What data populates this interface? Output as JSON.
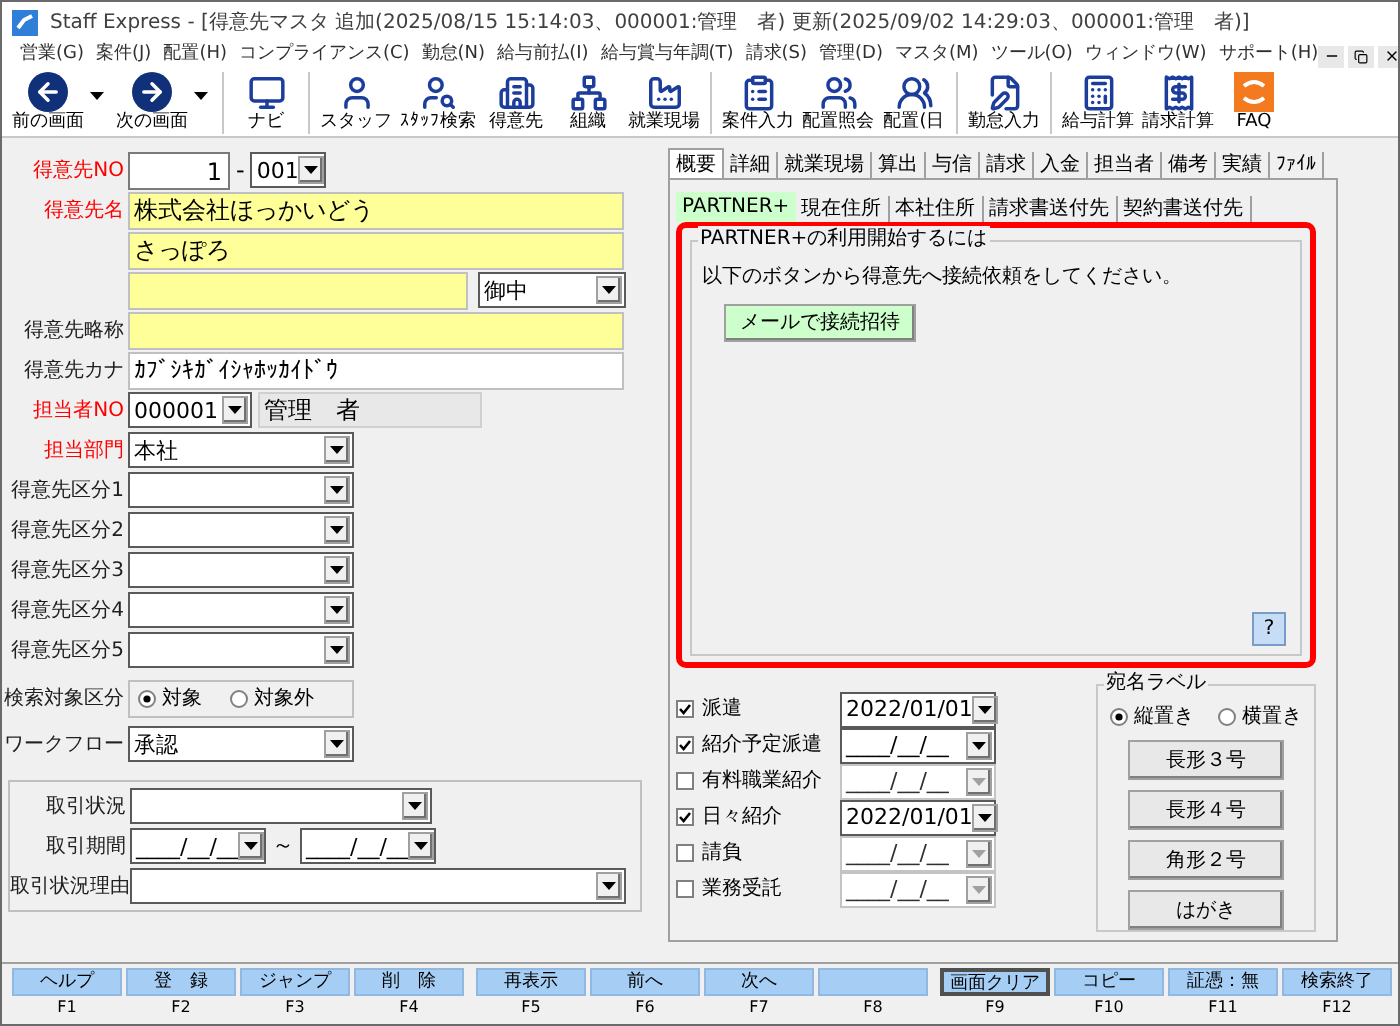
{
  "window": {
    "title": "Staff Express - [得意先マスタ  追加(2025/08/15 15:14:03、000001:管理　者) 更新(2025/09/02 14:29:03、000001:管理　者)]"
  },
  "menu": [
    {
      "label": "営業(G)"
    },
    {
      "label": "案件(J)"
    },
    {
      "label": "配置(H)"
    },
    {
      "label": "コンプライアンス(C)"
    },
    {
      "label": "勤怠(N)"
    },
    {
      "label": "給与前払(I)"
    },
    {
      "label": "給与賞与年調(T)"
    },
    {
      "label": "請求(S)"
    },
    {
      "label": "管理(D)"
    },
    {
      "label": "マスタ(M)"
    },
    {
      "label": "ツール(O)"
    },
    {
      "label": "ウィンドウ(W)"
    },
    {
      "label": "サポート(H)"
    }
  ],
  "toolbar": [
    {
      "items": [
        {
          "label": "前の画面",
          "dropdown": true
        },
        {
          "label": "次の画面",
          "dropdown": true
        }
      ]
    },
    {
      "items": [
        {
          "label": "ナビ",
          "dropdown": false
        }
      ]
    },
    {
      "items": [
        {
          "label": "スタッフ",
          "dropdown": false
        },
        {
          "label": "ｽﾀｯﾌ検索",
          "dropdown": false
        },
        {
          "label": "得意先",
          "dropdown": false
        },
        {
          "label": "組織",
          "dropdown": false
        },
        {
          "label": "就業現場",
          "dropdown": false
        }
      ]
    },
    {
      "items": [
        {
          "label": "案件入力",
          "dropdown": false
        },
        {
          "label": "配置照会",
          "dropdown": false
        },
        {
          "label": "配置(日",
          "dropdown": false
        }
      ]
    },
    {
      "items": [
        {
          "label": "勤怠入力",
          "dropdown": false
        }
      ]
    },
    {
      "items": [
        {
          "label": "給与計算",
          "dropdown": false
        },
        {
          "label": "請求計算",
          "dropdown": false
        },
        {
          "label": "FAQ",
          "dropdown": false
        }
      ]
    }
  ],
  "form": {
    "rows": [
      {
        "kind": "number",
        "label": "得意先NO",
        "required": true,
        "value": "1",
        "separator": "-",
        "code": "001"
      },
      {
        "kind": "text",
        "label": "得意先名",
        "required": true,
        "value": "株式会社ほっかいどう",
        "highlight": true
      },
      {
        "kind": "text",
        "value": "さっぽろ",
        "highlight": true
      },
      {
        "kind": "text_select",
        "highlight": true,
        "select": "御中"
      },
      {
        "kind": "text",
        "label": "得意先略称",
        "required": false,
        "highlight": true
      },
      {
        "kind": "text",
        "label": "得意先カナ",
        "required": false,
        "value": "ｶﾌﾞｼｷｶﾞｲｼｬﾎｯｶｲﾄﾞｳ",
        "highlight": false
      },
      {
        "kind": "staff",
        "label": "担当者NO",
        "required": true,
        "value": "000001",
        "name": "管理　者"
      },
      {
        "kind": "select",
        "label": "担当部門",
        "required": true,
        "value": "本社"
      },
      {
        "kind": "select",
        "label": "得意先区分1",
        "required": false
      },
      {
        "kind": "select",
        "label": "得意先区分2",
        "required": false
      },
      {
        "kind": "select",
        "label": "得意先区分3",
        "required": false
      },
      {
        "kind": "select",
        "label": "得意先区分4",
        "required": false
      },
      {
        "kind": "select",
        "label": "得意先区分5",
        "required": false
      },
      {
        "kind": "radio",
        "label": "検索対象区分",
        "required": false,
        "options": [
          {
            "label": "対象",
            "selected": true
          },
          {
            "label": "対象外",
            "selected": false
          }
        ]
      },
      {
        "kind": "select",
        "label": "ワークフロー",
        "required": false,
        "value": "承認"
      }
    ]
  },
  "transaction": {
    "rows": [
      {
        "kind": "select",
        "label": "取引状況"
      },
      {
        "kind": "date_range",
        "label": "取引期間",
        "from": "____/__/__",
        "separator": "～",
        "to": "____/__/__"
      },
      {
        "kind": "select_wide",
        "label": "取引状況理由"
      }
    ]
  },
  "tabs": [
    {
      "label": "概要",
      "selected": true
    },
    {
      "label": "詳細",
      "selected": false
    },
    {
      "label": "就業現場",
      "selected": false
    },
    {
      "label": "算出",
      "selected": false
    },
    {
      "label": "与信",
      "selected": false
    },
    {
      "label": "請求",
      "selected": false
    },
    {
      "label": "入金",
      "selected": false
    },
    {
      "label": "担当者",
      "selected": false
    },
    {
      "label": "備考",
      "selected": false
    },
    {
      "label": "実績",
      "selected": false
    },
    {
      "label": "ﾌｧｲﾙ",
      "selected": false
    }
  ],
  "subtabs": [
    {
      "label": "PARTNER+",
      "selected": true
    },
    {
      "label": "現在住所",
      "selected": false
    },
    {
      "label": "本社住所",
      "selected": false
    },
    {
      "label": "請求書送付先",
      "selected": false
    },
    {
      "label": "契約書送付先",
      "selected": false
    }
  ],
  "partner": {
    "highlighted": true,
    "title": "PARTNER+の利用開始するには",
    "message": "以下のボタンから得意先へ接続依頼をしてください。",
    "button": "メールで接続招待",
    "help": "?"
  },
  "contracts": [
    {
      "label": "派遣",
      "checked": true,
      "date": "2022/01/01",
      "disabled": false
    },
    {
      "label": "紹介予定派遣",
      "checked": true,
      "date": "____/__/__",
      "disabled": false
    },
    {
      "label": "有料職業紹介",
      "checked": false,
      "date": "____/__/__",
      "disabled": true
    },
    {
      "label": "日々紹介",
      "checked": true,
      "date": "2022/01/01",
      "disabled": false
    },
    {
      "label": "請負",
      "checked": false,
      "date": "____/__/__",
      "disabled": true
    },
    {
      "label": "業務受託",
      "checked": false,
      "date": "____/__/__",
      "disabled": true
    }
  ],
  "address_label": {
    "title": "宛名ラベル",
    "options": [
      {
        "label": "縦置き",
        "selected": true
      },
      {
        "label": "横置き",
        "selected": false
      }
    ],
    "buttons": [
      "長形３号",
      "長形４号",
      "角形２号",
      "はがき"
    ]
  },
  "function_keys": [
    {
      "label": "ヘルプ",
      "key": "F1",
      "focused": false
    },
    {
      "label": "登　録",
      "key": "F2",
      "focused": false
    },
    {
      "label": "ジャンプ",
      "key": "F3",
      "focused": false
    },
    {
      "label": "削　除",
      "key": "F4",
      "focused": false
    },
    {
      "label": "再表示",
      "key": "F5",
      "focused": false
    },
    {
      "label": "前へ",
      "key": "F6",
      "focused": false
    },
    {
      "label": "次へ",
      "key": "F7",
      "focused": false
    },
    {
      "key": "F8",
      "focused": false
    },
    {
      "label": "画面クリア",
      "key": "F9",
      "focused": true
    },
    {
      "label": "コピー",
      "key": "F10",
      "focused": false
    },
    {
      "label": "証憑：無",
      "key": "F11",
      "focused": false
    },
    {
      "label": "検索終了",
      "key": "F12",
      "focused": false
    }
  ]
}
